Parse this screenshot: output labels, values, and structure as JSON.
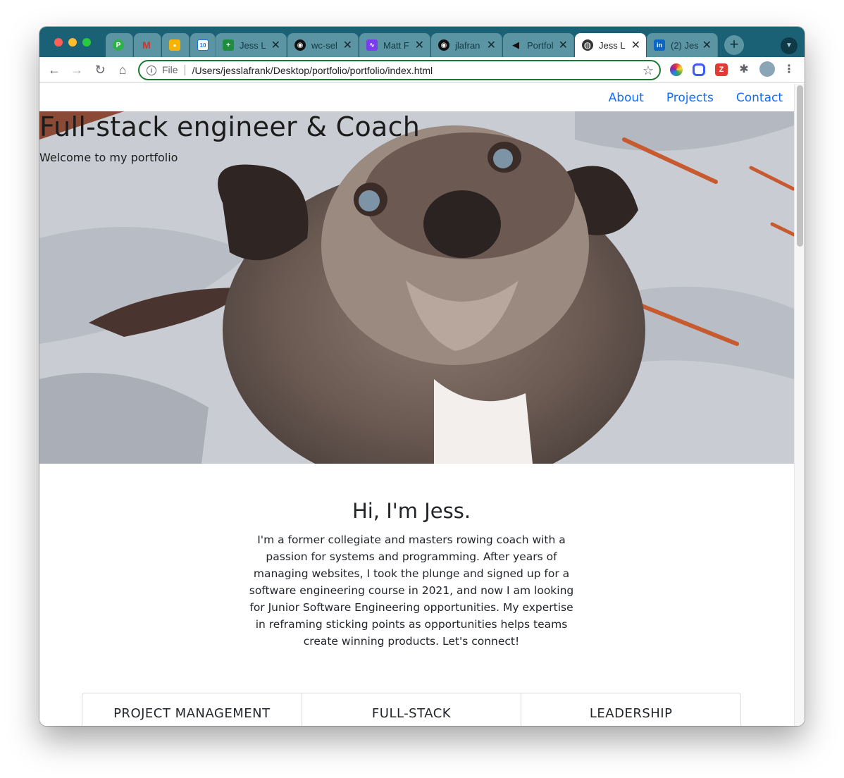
{
  "browser": {
    "tabs": [
      {
        "title": "",
        "icon": "app-icon",
        "color": "#2fb04a",
        "glyph": "P"
      },
      {
        "title": "",
        "icon": "gmail-icon",
        "color": "#5b94a3",
        "glyph": "M"
      },
      {
        "title": "",
        "icon": "keep-icon",
        "color": "#f6b400",
        "glyph": "●"
      },
      {
        "title": "",
        "icon": "calendar-icon",
        "color": "#ffffff",
        "glyph": "10"
      },
      {
        "title": "Jess L",
        "icon": "sheets-icon",
        "color": "#1e8e3e",
        "glyph": "+"
      },
      {
        "title": "wc-sel",
        "icon": "github-icon",
        "color": "#111111",
        "glyph": "◉"
      },
      {
        "title": "Matt F",
        "icon": "analytics-icon",
        "color": "#7b3cf0",
        "glyph": "∿"
      },
      {
        "title": "jlafran",
        "icon": "github-icon",
        "color": "#111111",
        "glyph": "◉"
      },
      {
        "title": "Portfol",
        "icon": "megaphone-icon",
        "color": "#111111",
        "glyph": "◀"
      },
      {
        "title": "Jess L",
        "icon": "globe-icon",
        "color": "#333333",
        "glyph": "◍",
        "active": true
      },
      {
        "title": "(2) Jes",
        "icon": "linkedin-icon",
        "color": "#0a66c2",
        "glyph": "in"
      }
    ],
    "address": {
      "scheme": "File",
      "url": "/Users/jesslafrank/Desktop/portfolio/portfolio/index.html"
    }
  },
  "site": {
    "nav": [
      "About",
      "Projects",
      "Contact"
    ],
    "hero": {
      "title": "Full-stack engineer & Coach",
      "subtitle": "Welcome to my portfolio"
    },
    "intro": {
      "heading": "Hi, I'm Jess.",
      "body": "I'm a former collegiate and masters rowing coach with a passion for systems and programming. After years of managing websites, I took the plunge and signed up for a software engineering course in 2021, and now I am looking for Junior Software Engineering opportunities. My expertise in reframing sticking points as opportunities helps teams create winning products. Let's connect!"
    },
    "skills": [
      "PROJECT MANAGEMENT",
      "FULL-STACK",
      "LEADERSHIP"
    ]
  },
  "colors": {
    "tabstrip": "#1b6176",
    "link": "#0d6efd",
    "omnibox_border": "#1a7a33"
  }
}
